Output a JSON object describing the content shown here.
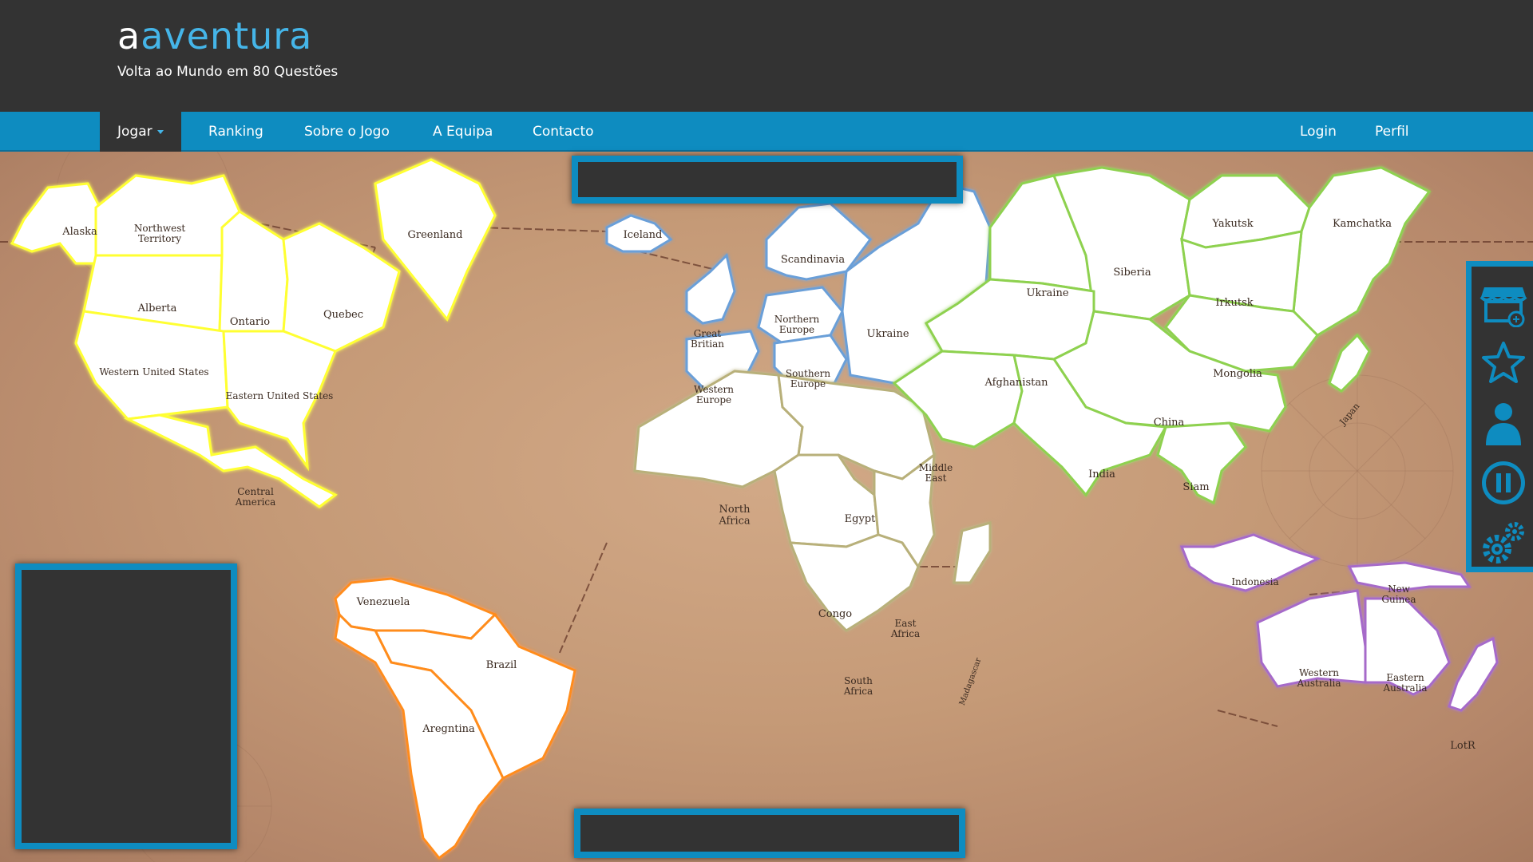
{
  "header": {
    "brand_prefix": "a",
    "brand_rest": "aventura",
    "tagline": "Volta ao Mundo em 80 Questões"
  },
  "nav": {
    "left": [
      {
        "label": "Jogar",
        "active": true
      },
      {
        "label": "Ranking"
      },
      {
        "label": "Sobre o Jogo"
      },
      {
        "label": "A Equipa"
      },
      {
        "label": "Contacto"
      }
    ],
    "right": [
      {
        "label": "Login"
      },
      {
        "label": "Perfil"
      }
    ]
  },
  "colors": {
    "accent": "#45b5e8",
    "nav_bg": "#0e8cc0",
    "dark": "#333333",
    "north_america": "#ffff33",
    "south_america": "#ff8c1a",
    "europe": "#6a9fd8",
    "africa": "#b8b07a",
    "asia": "#8ed14f",
    "oceania": "#a66bc9"
  },
  "territories": {
    "alaska": "Alaska",
    "northwest_territory": "Northwest Territory",
    "greenland": "Greenland",
    "alberta": "Alberta",
    "ontario": "Ontario",
    "quebec": "Quebec",
    "western_us": "Western United States",
    "eastern_us": "Eastern United States",
    "central_america": "Central America",
    "venezuela": "Venezuela",
    "brazil": "Brazil",
    "argentina": "Aregntina",
    "iceland": "Iceland",
    "scandinavia": "Scandinavia",
    "great_britain": "Great Britian",
    "northern_europe": "Northern Europe",
    "western_europe": "Western Europe",
    "southern_europe": "Southern Europe",
    "ukraine_eu": "Ukraine",
    "north_africa": "North Africa",
    "egypt": "Egypt",
    "congo": "Congo",
    "east_africa": "East Africa",
    "south_africa": "South Africa",
    "madagascar": "Madagascar",
    "ukraine_asia": "Ukraine",
    "siberia": "Siberia",
    "yakutsk": "Yakutsk",
    "kamchatka": "Kamchatka",
    "irkutsk": "Irkutsk",
    "mongolia": "Mongolia",
    "japan": "Japan",
    "afghanistan": "Afghanistan",
    "china": "China",
    "middle_east": "Middle East",
    "india": "India",
    "siam": "Siam",
    "indonesia": "Indonesia",
    "new_guinea": "New Guinea",
    "western_australia": "Western Australia",
    "eastern_australia": "Eastern Australia",
    "lotr": "LotR"
  },
  "toolbar": {
    "icons": [
      "shop-icon",
      "star-icon",
      "profile-icon",
      "pause-icon",
      "settings-icon"
    ]
  }
}
